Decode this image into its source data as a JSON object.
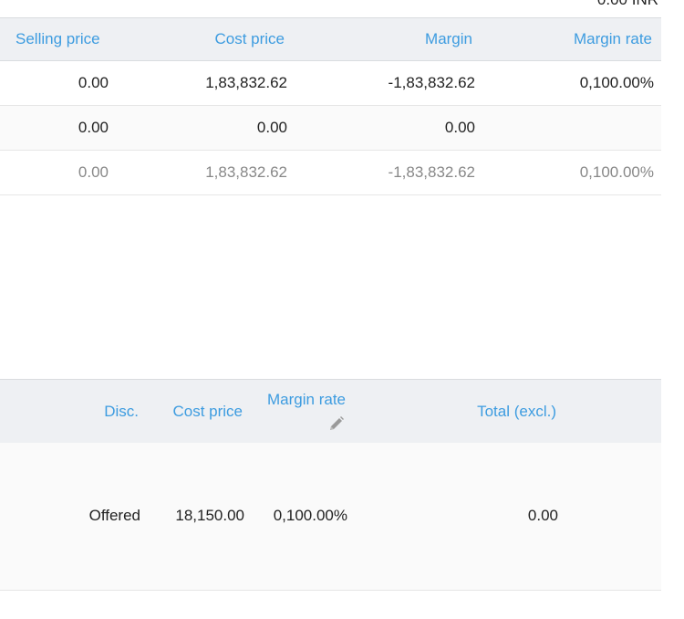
{
  "header": {
    "total": "0.00 INR"
  },
  "summary": {
    "columns": [
      "Selling price",
      "Cost price",
      "Margin",
      "Margin rate"
    ],
    "rows": [
      [
        "0.00",
        "1,83,832.62",
        "-1,83,832.62",
        "0,100.00%"
      ],
      [
        "0.00",
        "0.00",
        "0.00",
        ""
      ],
      [
        "0.00",
        "1,83,832.62",
        "-1,83,832.62",
        "0,100.00%"
      ]
    ]
  },
  "lines": {
    "columns": {
      "disc": "Disc.",
      "cost": "Cost price",
      "margin": "Margin rate",
      "total": "Total (excl.)"
    },
    "edit_icon": "pencil-icon",
    "rows": [
      {
        "disc": "Offered",
        "cost": "18,150.00",
        "margin": "0,100.00%",
        "total": "0.00"
      }
    ]
  },
  "colors": {
    "accent": "#3d9ce0",
    "header_bg": "#eef0f3",
    "muted_text": "#888888"
  }
}
